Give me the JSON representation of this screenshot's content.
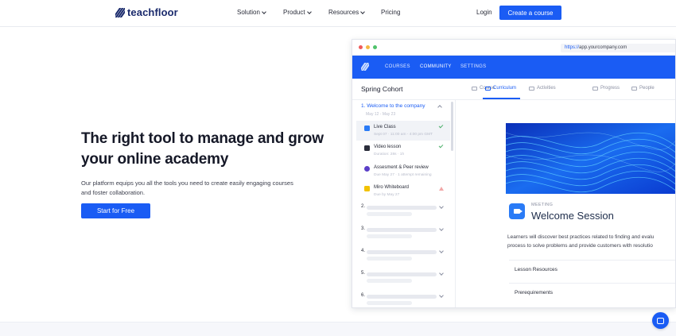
{
  "nav": {
    "logo_text": "teachfloor",
    "items": [
      {
        "label": "Solution",
        "dropdown": true
      },
      {
        "label": "Product",
        "dropdown": true
      },
      {
        "label": "Resources",
        "dropdown": true
      },
      {
        "label": "Pricing",
        "dropdown": false
      }
    ],
    "login_label": "Login",
    "cta_label": "Create a course"
  },
  "hero": {
    "title": "The right tool to manage and grow your online academy",
    "subtitle": "Our platform equips you all the tools you need to create easily engaging courses and foster collaboration.",
    "cta_label": "Start for Free"
  },
  "mockup": {
    "url_scheme": "https://",
    "url_rest": "app.yourcompany.com",
    "app_tabs": [
      "COURSES",
      "COMMUNITY",
      "SETTINGS"
    ],
    "active_app_tab": "COMMUNITY",
    "cohort_title": "Spring Cohort",
    "sub_tabs": [
      {
        "label": "Course",
        "icon": "course-icon"
      },
      {
        "label": "Curriculum",
        "icon": "curriculum-icon"
      },
      {
        "label": "Activities",
        "icon": "activities-icon"
      },
      {
        "label": "Progress",
        "icon": "progress-icon"
      },
      {
        "label": "People",
        "icon": "people-icon"
      }
    ],
    "active_sub_tab": "Curriculum",
    "module1": {
      "title": "1. Welcome to the company",
      "date": "May 12 - May 23"
    },
    "lessons": [
      {
        "name": "Live Class",
        "meta": "Sept 07 · 11:00 am - 4:00 pm GMT",
        "icon": "video-camera-icon",
        "color": "#2a7bf6",
        "status": "done"
      },
      {
        "name": "Video lesson",
        "meta": "Duration: 28s · 1h",
        "icon": "film-icon",
        "color": "#2a2d3a",
        "status": "done"
      },
      {
        "name": "Assesment & Peer review",
        "meta": "Due May 27 · 1 attempt remaining",
        "icon": "globe-icon",
        "color": "#5b3fc8",
        "status": "none"
      },
      {
        "name": "Miro Whiteboard",
        "meta": "Due by May 27",
        "icon": "miro-icon",
        "color": "#f2c200",
        "status": "warning"
      }
    ],
    "modules": [
      "2.",
      "3.",
      "4.",
      "5.",
      "6."
    ],
    "meeting_label": "MEETING",
    "session_title": "Welcome Session",
    "description_line1": "Learners will discover best practices related to finding and evalu",
    "description_line2": "process to solve problems and provide customers with resolutio",
    "accordions": [
      "Lesson Resources",
      "Prerequirements"
    ]
  },
  "colors": {
    "primary": "#1a5cf4",
    "dark": "#151827",
    "success": "#4caf6a"
  }
}
